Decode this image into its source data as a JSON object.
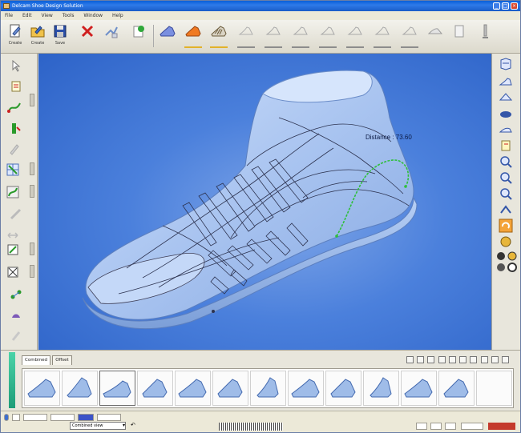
{
  "window": {
    "title": "Delcam Shoe Design Solution"
  },
  "menu": [
    "File",
    "Edit",
    "View",
    "Tools",
    "Window",
    "Help"
  ],
  "toolbar": {
    "buttons": [
      {
        "icon": "new-document-icon",
        "label": "Create"
      },
      {
        "icon": "open-folder-icon",
        "label": "Create"
      },
      {
        "icon": "save-icon",
        "label": "Save"
      }
    ]
  },
  "viewport": {
    "measure_text": "Distance : 73.60"
  },
  "bottom": {
    "tabs": [
      "Combined",
      "Offset"
    ]
  },
  "status": {
    "dropdown": "Combined view"
  },
  "colors": {
    "accent": "#e2b22a",
    "viewport_bg": "#4b80dc",
    "highlight_curve": "#2fbf3b"
  }
}
